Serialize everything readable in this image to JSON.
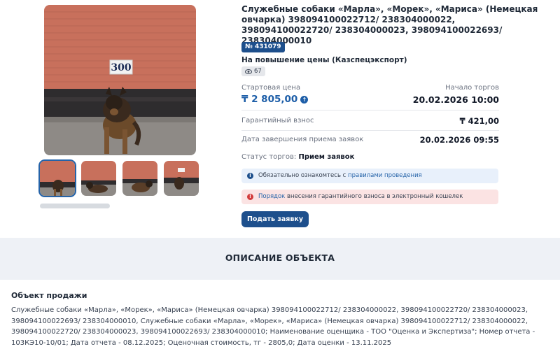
{
  "lot": {
    "title": "Служебные собаки «Марла», «Морек», «Мариса» (Немецкая овчарка) 398094100022712/ 238304000022, 398094100022720/ 238304000023, 398094100022693/ 238304000010",
    "number_badge": "№ 431079",
    "auction_type": "На повышение цены (Казспецэкспорт)",
    "views": "67",
    "photo_plate_number": "300"
  },
  "pricing": {
    "start_price_label": "Стартовая цена",
    "start_price_value": "₸ 2 805,00",
    "start_date_label": "Начало торгов",
    "start_date_value": "20.02.2026 10:00",
    "deposit_label": "Гарантийный взнос",
    "deposit_value": "₸ 421,00",
    "deadline_label": "Дата завершения приема заявок",
    "deadline_value": "20.02.2026 09:55",
    "status_label": "Статус торгов:",
    "status_value": "Прием заявок"
  },
  "notices": {
    "info_text": "Обязательно ознакомтесь с ",
    "info_link": "правилами проведения",
    "warn_link": "Порядок",
    "warn_text": " внесения гарантийного взноса в электронный кошелек"
  },
  "actions": {
    "submit_label": "Подать заявку"
  },
  "description": {
    "heading": "ОПИСАНИЕ ОБЪЕКТА",
    "sale_heading": "Объект продажи",
    "sale_text": "Служебные собаки «Марла», «Морек», «Мариса» (Немецкая овчарка) 398094100022712/ 238304000022, 398094100022720/ 238304000023, 398094100022693/ 238304000010, Служебные собаки «Марла», «Морек», «Мариса» (Немецкая овчарка) 398094100022712/ 238304000022, 398094100022720/ 238304000023, 398094100022693/ 238304000010; Наименование оценщика - ТОО \"Оценка и Экспертиза\"; Номер отчета - 103КЭ10-10/01; Дата отчета - 08.12.2025; Оценочная стоимость, тг - 2805,0; Дата оценки - 13.11.2025"
  },
  "icons": {
    "views": "eye-icon",
    "price_up": "arrow-up-circle-icon",
    "info": "info-icon",
    "warning": "alert-icon"
  },
  "colors": {
    "primary": "#1d4f8c",
    "price": "#1d5ea8",
    "info_bg": "#e8f0fb",
    "warn_bg": "#fbe3e3",
    "section_bg": "#eef1f6"
  }
}
